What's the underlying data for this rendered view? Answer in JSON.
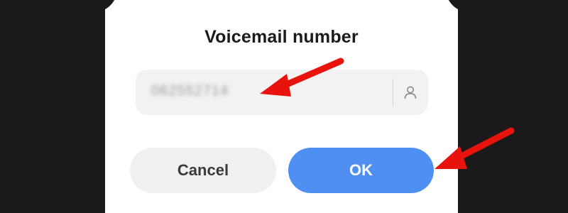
{
  "dialog": {
    "title": "Voicemail number",
    "input": {
      "value": "062552714"
    },
    "buttons": {
      "cancel_label": "Cancel",
      "ok_label": "OK"
    }
  },
  "icons": {
    "contact": "person-contact-icon",
    "annotation": "red-arrow-icon"
  },
  "colors": {
    "ok_button": "#4f8ff2",
    "cancel_button": "#f0f0f0",
    "annotation_arrow": "#e8130c"
  }
}
